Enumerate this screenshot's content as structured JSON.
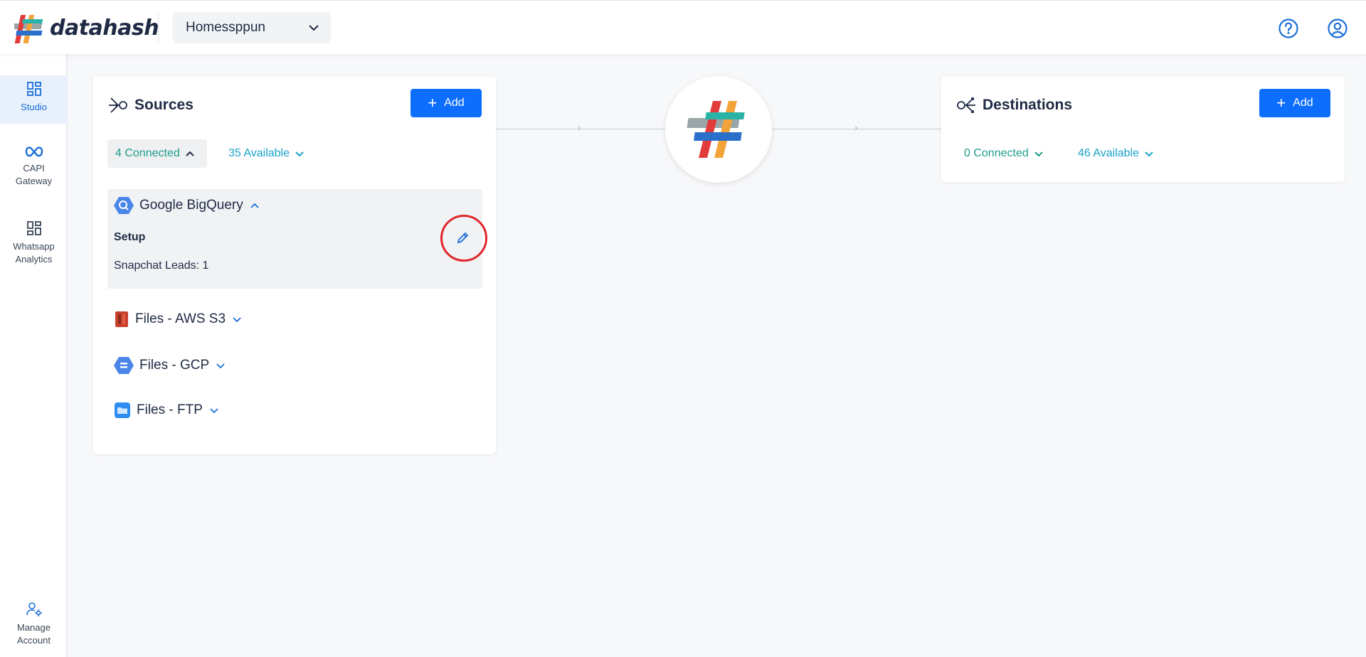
{
  "app": {
    "brand": "datahash"
  },
  "header": {
    "workspace": "Homessppun",
    "help_icon": "help-circle-icon",
    "account_icon": "user-circle-icon"
  },
  "sidebar": {
    "items": [
      {
        "label": "Studio",
        "icon": "dashboard-grid-icon",
        "active": true
      },
      {
        "label": "CAPI Gateway",
        "icon": "meta-infinity-icon",
        "active": false
      },
      {
        "label": "Whatsapp Analytics",
        "icon": "dashboard-grid-icon",
        "active": false
      },
      {
        "label": "Manage Account",
        "icon": "user-settings-icon",
        "active": false
      }
    ]
  },
  "sources": {
    "title": "Sources",
    "add_label": "Add",
    "connected_label": "4 Connected",
    "available_label": "35 Available",
    "items": [
      {
        "name": "Google BigQuery",
        "icon": "bigquery-icon",
        "expanded": true
      },
      {
        "name": "Files - AWS S3",
        "icon": "aws-s3-icon",
        "expanded": false
      },
      {
        "name": "Files - GCP",
        "icon": "gcp-storage-icon",
        "expanded": false
      },
      {
        "name": "Files - FTP",
        "icon": "folder-icon",
        "expanded": false
      }
    ],
    "expanded_detail": {
      "setup_label": "Setup",
      "detail": "Snapchat Leads: 1"
    }
  },
  "destinations": {
    "title": "Destinations",
    "add_label": "Add",
    "connected_label": "0 Connected",
    "available_label": "46 Available"
  },
  "colors": {
    "primary": "#0d6efd",
    "connected": "#1f9d8a",
    "available": "#1aa3c9",
    "annotation": "#e0262c"
  }
}
